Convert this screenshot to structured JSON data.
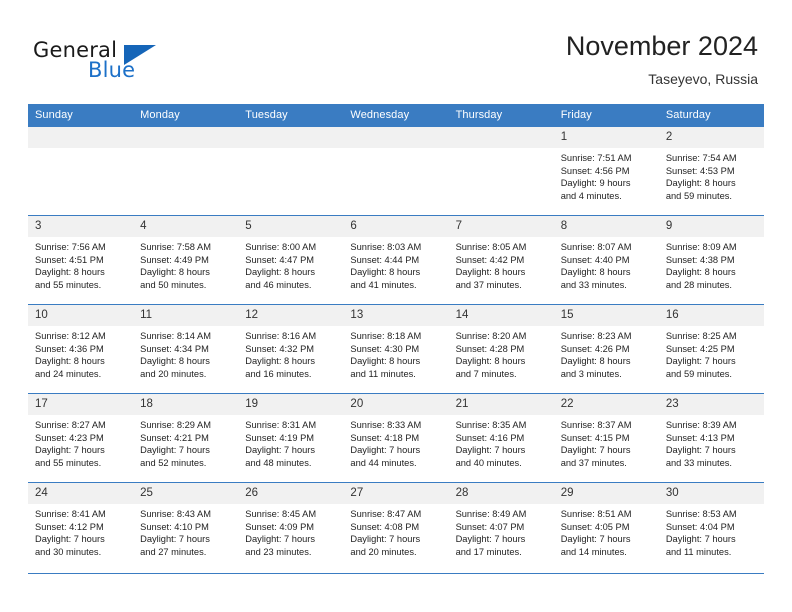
{
  "brand": {
    "name_part1": "General",
    "name_part2": "Blue",
    "triangle_color": "#1565b8",
    "blue_color": "#1c70c8"
  },
  "header": {
    "month_title": "November 2024",
    "location": "Taseyevo, Russia"
  },
  "theme": {
    "header_blue": "#3a7cc2",
    "daynum_bg": "#f1f1f1",
    "text": "#1f1f1f"
  },
  "weekdays": [
    "Sunday",
    "Monday",
    "Tuesday",
    "Wednesday",
    "Thursday",
    "Friday",
    "Saturday"
  ],
  "weeks": [
    [
      {
        "day": "",
        "sunrise": "",
        "sunset": "",
        "daylight_line1": "",
        "daylight_line2": ""
      },
      {
        "day": "",
        "sunrise": "",
        "sunset": "",
        "daylight_line1": "",
        "daylight_line2": ""
      },
      {
        "day": "",
        "sunrise": "",
        "sunset": "",
        "daylight_line1": "",
        "daylight_line2": ""
      },
      {
        "day": "",
        "sunrise": "",
        "sunset": "",
        "daylight_line1": "",
        "daylight_line2": ""
      },
      {
        "day": "",
        "sunrise": "",
        "sunset": "",
        "daylight_line1": "",
        "daylight_line2": ""
      },
      {
        "day": "1",
        "sunrise": "Sunrise: 7:51 AM",
        "sunset": "Sunset: 4:56 PM",
        "daylight_line1": "Daylight: 9 hours",
        "daylight_line2": "and 4 minutes."
      },
      {
        "day": "2",
        "sunrise": "Sunrise: 7:54 AM",
        "sunset": "Sunset: 4:53 PM",
        "daylight_line1": "Daylight: 8 hours",
        "daylight_line2": "and 59 minutes."
      }
    ],
    [
      {
        "day": "3",
        "sunrise": "Sunrise: 7:56 AM",
        "sunset": "Sunset: 4:51 PM",
        "daylight_line1": "Daylight: 8 hours",
        "daylight_line2": "and 55 minutes."
      },
      {
        "day": "4",
        "sunrise": "Sunrise: 7:58 AM",
        "sunset": "Sunset: 4:49 PM",
        "daylight_line1": "Daylight: 8 hours",
        "daylight_line2": "and 50 minutes."
      },
      {
        "day": "5",
        "sunrise": "Sunrise: 8:00 AM",
        "sunset": "Sunset: 4:47 PM",
        "daylight_line1": "Daylight: 8 hours",
        "daylight_line2": "and 46 minutes."
      },
      {
        "day": "6",
        "sunrise": "Sunrise: 8:03 AM",
        "sunset": "Sunset: 4:44 PM",
        "daylight_line1": "Daylight: 8 hours",
        "daylight_line2": "and 41 minutes."
      },
      {
        "day": "7",
        "sunrise": "Sunrise: 8:05 AM",
        "sunset": "Sunset: 4:42 PM",
        "daylight_line1": "Daylight: 8 hours",
        "daylight_line2": "and 37 minutes."
      },
      {
        "day": "8",
        "sunrise": "Sunrise: 8:07 AM",
        "sunset": "Sunset: 4:40 PM",
        "daylight_line1": "Daylight: 8 hours",
        "daylight_line2": "and 33 minutes."
      },
      {
        "day": "9",
        "sunrise": "Sunrise: 8:09 AM",
        "sunset": "Sunset: 4:38 PM",
        "daylight_line1": "Daylight: 8 hours",
        "daylight_line2": "and 28 minutes."
      }
    ],
    [
      {
        "day": "10",
        "sunrise": "Sunrise: 8:12 AM",
        "sunset": "Sunset: 4:36 PM",
        "daylight_line1": "Daylight: 8 hours",
        "daylight_line2": "and 24 minutes."
      },
      {
        "day": "11",
        "sunrise": "Sunrise: 8:14 AM",
        "sunset": "Sunset: 4:34 PM",
        "daylight_line1": "Daylight: 8 hours",
        "daylight_line2": "and 20 minutes."
      },
      {
        "day": "12",
        "sunrise": "Sunrise: 8:16 AM",
        "sunset": "Sunset: 4:32 PM",
        "daylight_line1": "Daylight: 8 hours",
        "daylight_line2": "and 16 minutes."
      },
      {
        "day": "13",
        "sunrise": "Sunrise: 8:18 AM",
        "sunset": "Sunset: 4:30 PM",
        "daylight_line1": "Daylight: 8 hours",
        "daylight_line2": "and 11 minutes."
      },
      {
        "day": "14",
        "sunrise": "Sunrise: 8:20 AM",
        "sunset": "Sunset: 4:28 PM",
        "daylight_line1": "Daylight: 8 hours",
        "daylight_line2": "and 7 minutes."
      },
      {
        "day": "15",
        "sunrise": "Sunrise: 8:23 AM",
        "sunset": "Sunset: 4:26 PM",
        "daylight_line1": "Daylight: 8 hours",
        "daylight_line2": "and 3 minutes."
      },
      {
        "day": "16",
        "sunrise": "Sunrise: 8:25 AM",
        "sunset": "Sunset: 4:25 PM",
        "daylight_line1": "Daylight: 7 hours",
        "daylight_line2": "and 59 minutes."
      }
    ],
    [
      {
        "day": "17",
        "sunrise": "Sunrise: 8:27 AM",
        "sunset": "Sunset: 4:23 PM",
        "daylight_line1": "Daylight: 7 hours",
        "daylight_line2": "and 55 minutes."
      },
      {
        "day": "18",
        "sunrise": "Sunrise: 8:29 AM",
        "sunset": "Sunset: 4:21 PM",
        "daylight_line1": "Daylight: 7 hours",
        "daylight_line2": "and 52 minutes."
      },
      {
        "day": "19",
        "sunrise": "Sunrise: 8:31 AM",
        "sunset": "Sunset: 4:19 PM",
        "daylight_line1": "Daylight: 7 hours",
        "daylight_line2": "and 48 minutes."
      },
      {
        "day": "20",
        "sunrise": "Sunrise: 8:33 AM",
        "sunset": "Sunset: 4:18 PM",
        "daylight_line1": "Daylight: 7 hours",
        "daylight_line2": "and 44 minutes."
      },
      {
        "day": "21",
        "sunrise": "Sunrise: 8:35 AM",
        "sunset": "Sunset: 4:16 PM",
        "daylight_line1": "Daylight: 7 hours",
        "daylight_line2": "and 40 minutes."
      },
      {
        "day": "22",
        "sunrise": "Sunrise: 8:37 AM",
        "sunset": "Sunset: 4:15 PM",
        "daylight_line1": "Daylight: 7 hours",
        "daylight_line2": "and 37 minutes."
      },
      {
        "day": "23",
        "sunrise": "Sunrise: 8:39 AM",
        "sunset": "Sunset: 4:13 PM",
        "daylight_line1": "Daylight: 7 hours",
        "daylight_line2": "and 33 minutes."
      }
    ],
    [
      {
        "day": "24",
        "sunrise": "Sunrise: 8:41 AM",
        "sunset": "Sunset: 4:12 PM",
        "daylight_line1": "Daylight: 7 hours",
        "daylight_line2": "and 30 minutes."
      },
      {
        "day": "25",
        "sunrise": "Sunrise: 8:43 AM",
        "sunset": "Sunset: 4:10 PM",
        "daylight_line1": "Daylight: 7 hours",
        "daylight_line2": "and 27 minutes."
      },
      {
        "day": "26",
        "sunrise": "Sunrise: 8:45 AM",
        "sunset": "Sunset: 4:09 PM",
        "daylight_line1": "Daylight: 7 hours",
        "daylight_line2": "and 23 minutes."
      },
      {
        "day": "27",
        "sunrise": "Sunrise: 8:47 AM",
        "sunset": "Sunset: 4:08 PM",
        "daylight_line1": "Daylight: 7 hours",
        "daylight_line2": "and 20 minutes."
      },
      {
        "day": "28",
        "sunrise": "Sunrise: 8:49 AM",
        "sunset": "Sunset: 4:07 PM",
        "daylight_line1": "Daylight: 7 hours",
        "daylight_line2": "and 17 minutes."
      },
      {
        "day": "29",
        "sunrise": "Sunrise: 8:51 AM",
        "sunset": "Sunset: 4:05 PM",
        "daylight_line1": "Daylight: 7 hours",
        "daylight_line2": "and 14 minutes."
      },
      {
        "day": "30",
        "sunrise": "Sunrise: 8:53 AM",
        "sunset": "Sunset: 4:04 PM",
        "daylight_line1": "Daylight: 7 hours",
        "daylight_line2": "and 11 minutes."
      }
    ]
  ]
}
